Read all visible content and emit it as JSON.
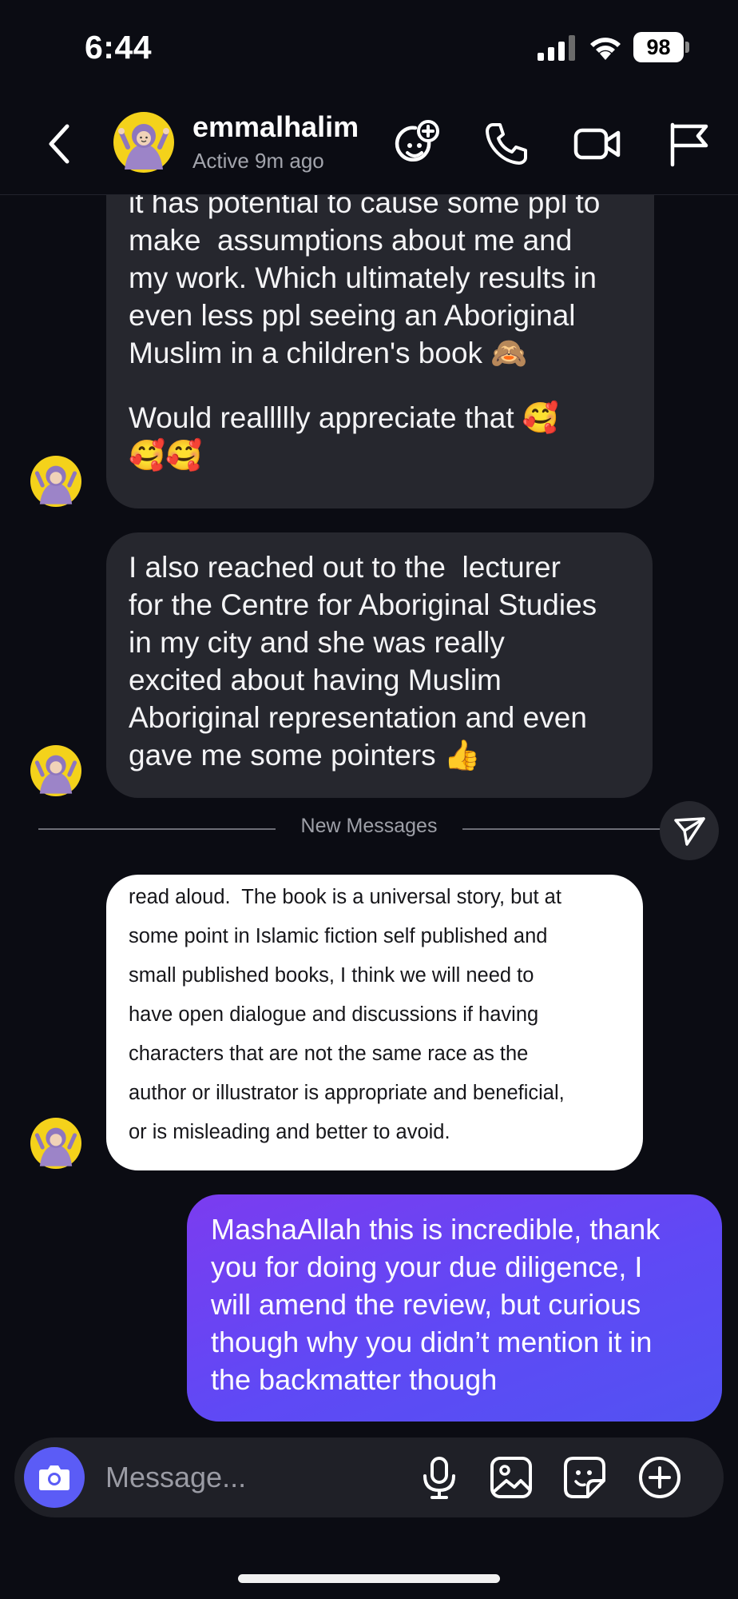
{
  "status_bar": {
    "time": "6:44",
    "battery": "98"
  },
  "header": {
    "name": "emmalhalim",
    "status": "Active 9m ago",
    "icons": [
      "back-chevron-icon",
      "effects-icon",
      "phone-icon",
      "video-camera-icon",
      "flag-icon"
    ]
  },
  "messages": [
    {
      "direction": "incoming",
      "text": "it has potential to cause some ppl to\nmake  assumptions about me and\nmy work. Which ultimately results in\neven less ppl seeing an Aboriginal\nMuslim in a children's book",
      "text_emoji": "🙈",
      "text2": "Would reallllly appreciate that",
      "text2_emoji": "🥰",
      "text3_emoji": "🥰🥰"
    },
    {
      "direction": "incoming",
      "text": "I also reached out to the  lecturer\nfor the Centre for Aboriginal Studies\nin my city and she was really\nexcited about having Muslim\nAboriginal representation and even\ngave me some pointers",
      "text_emoji": "👍"
    },
    {
      "direction": "incoming-forwarded",
      "text": "read aloud.  The book is a universal story, but at\nsome point in Islamic fiction self published and\nsmall published books, I think we will need to\nhave open dialogue and discussions if having\ncharacters that are not the same race as the\nauthor or illustrator is appropriate and beneficial,\nor is misleading and better to avoid."
    },
    {
      "direction": "outgoing",
      "text": "MashaAllah this is incredible, thank\nyou for doing your due diligence, I\nwill amend the review, but curious\nthough why you didn’t mention it in\nthe backmatter though"
    }
  ],
  "divider": {
    "label": "New Messages"
  },
  "composer": {
    "placeholder": "Message...",
    "icons": [
      "camera-icon",
      "microphone-icon",
      "gallery-icon",
      "sticker-icon",
      "plus-icon"
    ]
  },
  "colors": {
    "background": "#0b0c13",
    "incoming_bubble": "#26272e",
    "outgoing_bubble_start": "#7b3cf0",
    "outgoing_bubble_end": "#5252f2",
    "camera_button": "#5b5cf6"
  }
}
